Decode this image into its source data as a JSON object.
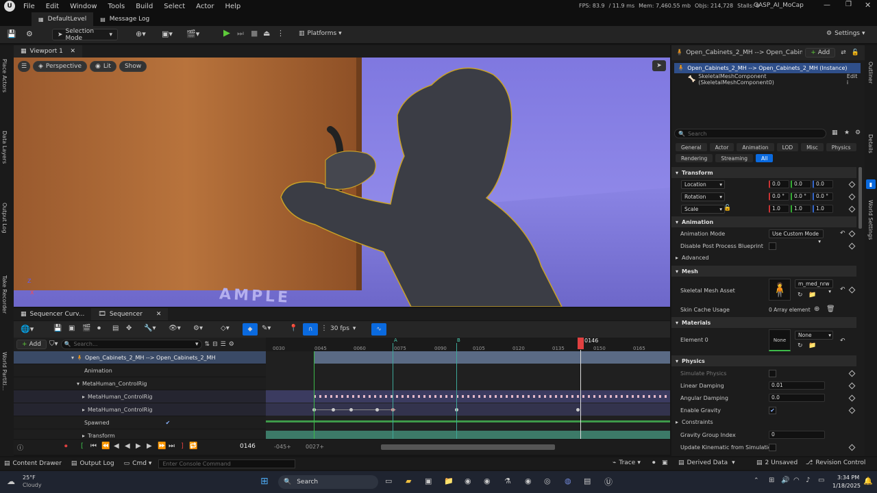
{
  "menu": [
    "File",
    "Edit",
    "Window",
    "Tools",
    "Build",
    "Select",
    "Actor",
    "Help"
  ],
  "stats": {
    "fps": "FPS: 83.9",
    "ms": "/ 11.9 ms",
    "mem": "Mem: 7,460.55 mb",
    "objs": "Objs: 214,728",
    "stalls": "Stalls: 0"
  },
  "project": "GASP_AI_MoCap",
  "tabs": {
    "level": "DefaultLevel",
    "log": "Message Log"
  },
  "toolbar": {
    "selection_mode": "Selection Mode",
    "platforms": "Platforms",
    "settings": "Settings"
  },
  "left_strip": [
    "Place Actors",
    "Data Layers",
    "Output Log",
    "Take Recorder",
    "World Partiti..."
  ],
  "viewport": {
    "tab": "Viewport 1",
    "perspective": "Perspective",
    "lit": "Lit",
    "show": "Show",
    "floor_text": "AMPLE",
    "axis_z": "Z",
    "axis_x": "X"
  },
  "sequencer": {
    "tab1": "Sequencer Curv...",
    "tab2": "Sequencer",
    "add": "Add",
    "search_placeholder": "Search...",
    "fps": "30 fps",
    "rows": [
      "Open_Cabinets_2_MH --> Open_Cabinets_2_MH",
      "Animation",
      "MetaHuman_ControlRig",
      "MetaHuman_ControlRig",
      "MetaHuman_ControlRig",
      "Spawned",
      "Transform"
    ],
    "ticks": [
      "0030",
      "0045",
      "0060",
      "0075",
      "0090",
      "0105",
      "0120",
      "0135",
      "0150",
      "0165"
    ],
    "marker_a": "A",
    "marker_b": "B",
    "playhead": "0146",
    "current_frame": "0146",
    "range_start": "-045+",
    "range_end": "0027+"
  },
  "outliner": {
    "title": "Open_Cabinets_2_MH --> Open_Cabine",
    "add": "Add",
    "item1": "Open_Cabinets_2_MH --> Open_Cabinets_2_MH (Instance)",
    "item2": "SkeletalMeshComponent (SkeletalMeshComponent0)",
    "item2_edit": "Edit i"
  },
  "details": {
    "search_placeholder": "Search",
    "filters": [
      "General",
      "Actor",
      "Animation",
      "LOD",
      "Misc",
      "Physics"
    ],
    "filters2": [
      "Rendering",
      "Streaming",
      "All"
    ],
    "transform": "Transform",
    "location": "Location",
    "rotation": "Rotation",
    "scale": "Scale",
    "loc_vals": [
      "0.0",
      "0.0",
      "0.0"
    ],
    "rot_vals": [
      "0.0 °",
      "0.0 °",
      "0.0 °"
    ],
    "scale_vals": [
      "1.0",
      "1.0",
      "1.0"
    ],
    "animation": "Animation",
    "animation_mode": "Animation Mode",
    "animation_mode_val": "Use Custom Mode",
    "disable_post": "Disable Post Process Blueprint",
    "advanced": "Advanced",
    "mesh": "Mesh",
    "skeletal_mesh_asset": "Skeletal Mesh Asset",
    "mesh_val": "m_med_nrw",
    "skin_cache": "Skin Cache Usage",
    "skin_cache_val": "0 Array element",
    "materials": "Materials",
    "element0": "Element 0",
    "none_thumb": "None",
    "none_dd": "None",
    "physics": "Physics",
    "simulate_physics": "Simulate Physics",
    "linear_damping": "Linear Damping",
    "linear_damping_val": "0.01",
    "angular_damping": "Angular Damping",
    "angular_damping_val": "0.0",
    "enable_gravity": "Enable Gravity",
    "constraints": "Constraints",
    "gravity_group": "Gravity Group Index",
    "gravity_group_val": "0",
    "update_kinematic": "Update Kinematic from Simulation"
  },
  "right_strip": [
    "Outliner",
    "Details",
    "World Settings"
  ],
  "statusbar": {
    "content_drawer": "Content Drawer",
    "output_log": "Output Log",
    "cmd": "Cmd",
    "console_placeholder": "Enter Console Command",
    "trace": "Trace",
    "derived_data": "Derived Data",
    "unsaved": "2 Unsaved",
    "revision": "Revision Control"
  },
  "taskbar": {
    "temp": "25°F",
    "weather": "Cloudy",
    "search": "Search",
    "time": "3:34 PM",
    "date": "1/18/2025"
  }
}
